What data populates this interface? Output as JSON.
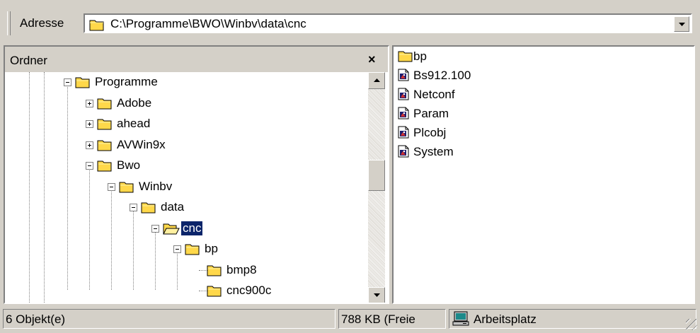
{
  "address": {
    "label": "Adresse",
    "path": "C:\\Programme\\BWO\\Winbv\\data\\cnc"
  },
  "folders_pane": {
    "title": "Ordner",
    "close": "×"
  },
  "tree": [
    {
      "label": "Programme",
      "level": 0,
      "expander": "minus",
      "selected": false
    },
    {
      "label": "Adobe",
      "level": 1,
      "expander": "plus",
      "selected": false
    },
    {
      "label": "ahead",
      "level": 1,
      "expander": "plus",
      "selected": false
    },
    {
      "label": "AVWin9x",
      "level": 1,
      "expander": "plus",
      "selected": false
    },
    {
      "label": "Bwo",
      "level": 1,
      "expander": "minus",
      "selected": false
    },
    {
      "label": "Winbv",
      "level": 2,
      "expander": "minus",
      "selected": false
    },
    {
      "label": "data",
      "level": 3,
      "expander": "minus",
      "selected": false
    },
    {
      "label": "cnc",
      "level": 4,
      "expander": "minus",
      "selected": true
    },
    {
      "label": "bp",
      "level": 5,
      "expander": "minus",
      "selected": false
    },
    {
      "label": "bmp8",
      "level": 6,
      "expander": "none",
      "selected": false
    },
    {
      "label": "cnc900c",
      "level": 6,
      "expander": "none",
      "selected": false
    }
  ],
  "files": [
    {
      "name": "bp",
      "icon": "folder-icon"
    },
    {
      "name": "Bs912.100",
      "icon": "file-icon"
    },
    {
      "name": "Netconf",
      "icon": "file-icon"
    },
    {
      "name": "Param",
      "icon": "file-icon"
    },
    {
      "name": "Plcobj",
      "icon": "file-icon"
    },
    {
      "name": "System",
      "icon": "file-icon"
    }
  ],
  "status": {
    "objects": "6 Objekt(e)",
    "free": "788 KB (Freie",
    "location": "Arbeitsplatz"
  },
  "colors": {
    "face": "#d4d0c8",
    "selection": "#0a246a",
    "folder": "#ffd84a"
  }
}
